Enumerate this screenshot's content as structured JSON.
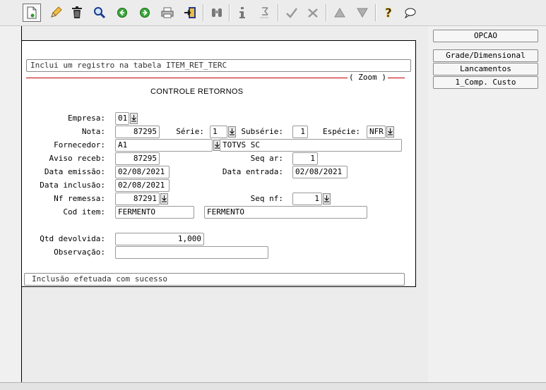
{
  "toolbar": {
    "icons": [
      "new-record-icon",
      "edit-icon",
      "delete-icon",
      "search-icon",
      "previous-icon",
      "next-icon",
      "print-icon",
      "export-icon",
      "binoculars-icon",
      "info-icon",
      "summation-icon",
      "confirm-icon",
      "cancel-icon",
      "up-icon",
      "down-icon",
      "help-icon",
      "chat-icon"
    ]
  },
  "info": {
    "text": "Inclui um registro na tabela ITEM_RET_TERC"
  },
  "zoom": {
    "label": "( Zoom )"
  },
  "section": {
    "title": "CONTROLE RETORNOS"
  },
  "labels": {
    "empresa": "Empresa:",
    "nota": "Nota:",
    "serie": "Série:",
    "subserie": "Subsérie:",
    "especie": "Espécie:",
    "fornecedor": "Fornecedor:",
    "aviso_receb": "Aviso receb:",
    "seq_ar": "Seq ar:",
    "data_emissao": "Data emissão:",
    "data_entrada": "Data entrada:",
    "data_inclusao": "Data inclusão:",
    "nf_remessa": "Nf remessa:",
    "seq_nf": "Seq nf:",
    "cod_item": "Cod item:",
    "qtd_devolvida": "Qtd devolvida:",
    "observacao": "Observação:"
  },
  "values": {
    "empresa": "01",
    "nota": "87295",
    "serie": "1",
    "subserie": "1",
    "especie": "NFR",
    "fornecedor_code": "A1",
    "fornecedor_name": "TOTVS SC",
    "aviso_receb": "87295",
    "seq_ar": "1",
    "data_emissao": "02/08/2021",
    "data_entrada": "02/08/2021",
    "data_inclusao": "02/08/2021",
    "nf_remessa": "87291",
    "seq_nf": "1",
    "cod_item": "FERMENTO",
    "item_desc": "FERMENTO",
    "qtd_devolvida": "1,000",
    "observacao": ""
  },
  "status": {
    "text": "Inclusão efetuada com sucesso"
  },
  "side_buttons": {
    "opcao": "OPCAO",
    "grade": "Grade/Dimensional",
    "lancamentos": "Lancamentos",
    "comp_custo": "1_Comp. Custo"
  }
}
